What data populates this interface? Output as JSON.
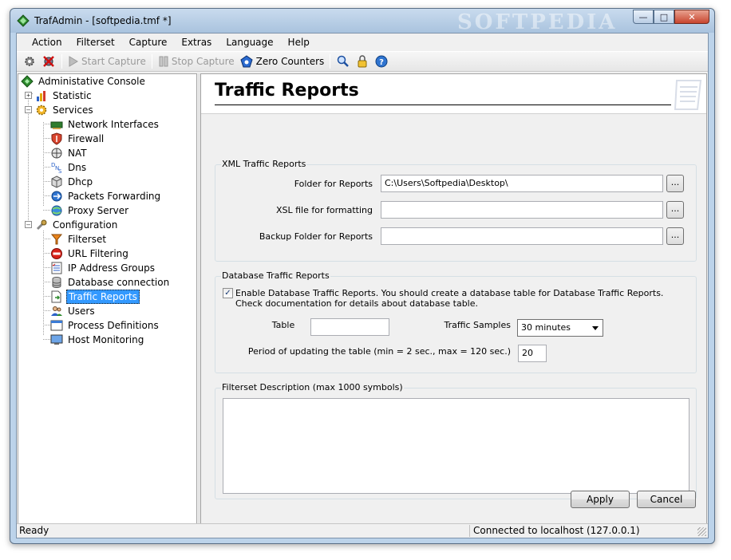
{
  "window": {
    "title": "TrafAdmin - [softpedia.tmf *]",
    "watermark": "SOFTPEDIA"
  },
  "menu": [
    "Action",
    "Filterset",
    "Capture",
    "Extras",
    "Language",
    "Help"
  ],
  "toolbar": {
    "start_capture": "Start Capture",
    "stop_capture": "Stop Capture",
    "zero_counters": "Zero Counters"
  },
  "tree": {
    "root": "Administative Console",
    "statistic": "Statistic",
    "services": "Services",
    "network_interfaces": "Network Interfaces",
    "firewall": "Firewall",
    "nat": "NAT",
    "dns": "Dns",
    "dhcp": "Dhcp",
    "packets_forwarding": "Packets Forwarding",
    "proxy_server": "Proxy Server",
    "configuration": "Configuration",
    "filterset": "Filterset",
    "url_filtering": "URL Filtering",
    "ip_address_groups": "IP Address Groups",
    "database_connection": "Database connection",
    "traffic_reports": "Traffic Reports",
    "users": "Users",
    "process_definitions": "Process Definitions",
    "host_monitoring": "Host Monitoring"
  },
  "page": {
    "title": "Traffic Reports",
    "xml_group": {
      "label": "XML Traffic Reports",
      "folder_label": "Folder for Reports",
      "folder_value": "C:\\Users\\Softpedia\\Desktop\\",
      "xsl_label": "XSL file for formatting",
      "xsl_value": "",
      "backup_label": "Backup Folder for Reports",
      "backup_value": "",
      "browse": "..."
    },
    "db_group": {
      "label": "Database Traffic Reports",
      "enable_text": "Enable Database Traffic Reports. You should create a database table for Database Traffic Reports. Check documentation for details about database table.",
      "enable_checked": true,
      "table_label": "Table",
      "table_value": "",
      "samples_label": "Traffic Samples",
      "samples_value": "30 minutes",
      "period_label": "Period of updating the table (min = 2 sec., max = 120 sec.)",
      "period_value": "20"
    },
    "desc_group": {
      "label": "Filterset Description (max 1000 symbols)"
    },
    "apply": "Apply",
    "cancel": "Cancel"
  },
  "status": {
    "left": "Ready",
    "right": "Connected to localhost (127.0.0.1)"
  }
}
